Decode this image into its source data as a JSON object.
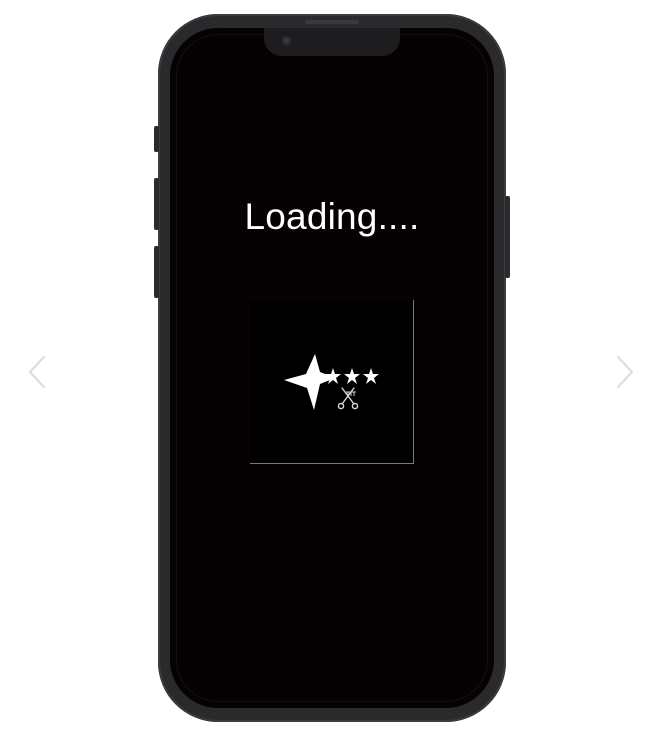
{
  "screen": {
    "loading_text": "Loading...."
  },
  "navigation": {
    "prev_icon": "chevron-left-icon",
    "next_icon": "chevron-right-icon"
  },
  "logo": {
    "icon": "stars-scissors-logo",
    "colors": {
      "background": "#000000",
      "mark": "#ffffff",
      "border": "#4a8ab0"
    }
  },
  "colors": {
    "page_background": "#ffffff",
    "phone_frame": "#2a2a2d",
    "screen_background": "#060102",
    "text": "#ffffff",
    "arrow": "#dddddd"
  }
}
